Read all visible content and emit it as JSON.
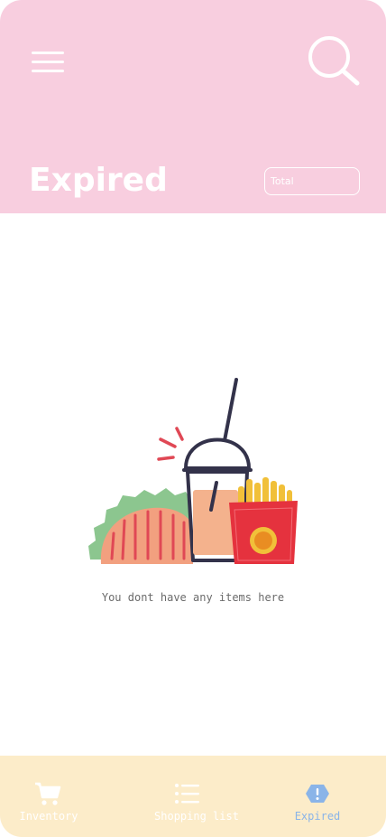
{
  "header": {
    "title": "Expired",
    "total_label": "Total"
  },
  "empty_state": {
    "message": "You dont have any items here"
  },
  "bottom_nav": {
    "items": [
      {
        "label": "Inventory",
        "icon": "cart-icon",
        "active": false
      },
      {
        "label": "Shopping list",
        "icon": "list-icon",
        "active": false
      },
      {
        "label": "Expired",
        "icon": "alert-icon",
        "active": true
      }
    ]
  },
  "colors": {
    "header_bg": "#f8cedf",
    "nav_bg": "#fcecc9",
    "active_nav": "#8ab4e8",
    "text_white": "#ffffff",
    "message_text": "#6b6b6b"
  }
}
